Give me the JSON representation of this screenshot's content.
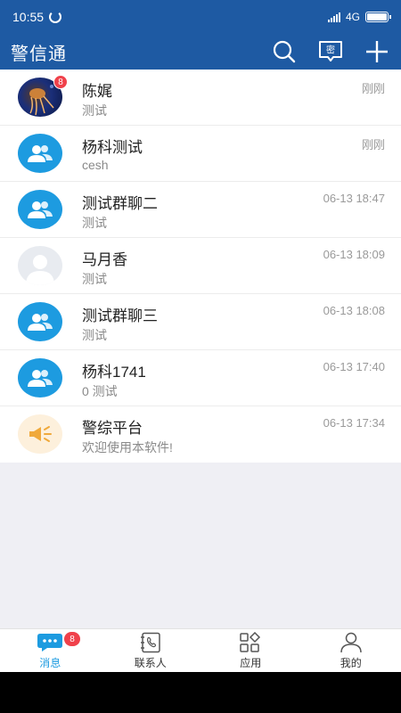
{
  "status_bar": {
    "time": "10:55",
    "network": "4G",
    "battery_level": 1.0
  },
  "header": {
    "title": "警信通",
    "icons": [
      "search-icon",
      "secret-chat-icon",
      "add-icon"
    ],
    "secret_label": "密"
  },
  "conversations": [
    {
      "name": "陈娓",
      "preview": "测试",
      "time": "刚刚",
      "avatar": "photo",
      "unread": "8"
    },
    {
      "name": "杨科测试",
      "preview": "cesh",
      "time": "刚刚",
      "avatar": "group"
    },
    {
      "name": "测试群聊二",
      "preview": "测试",
      "time": "06-13 18:47",
      "avatar": "group"
    },
    {
      "name": "马月香",
      "preview": "测试",
      "time": "06-13 18:09",
      "avatar": "person-default"
    },
    {
      "name": "测试群聊三",
      "preview": "测试",
      "time": "06-13 18:08",
      "avatar": "group"
    },
    {
      "name": "杨科1741",
      "preview": "0 测试",
      "time": "06-13 17:40",
      "avatar": "group"
    },
    {
      "name": "警综平台",
      "preview": "欢迎使用本软件!",
      "time": "06-13 17:34",
      "avatar": "notice"
    }
  ],
  "bottom_nav": {
    "items": [
      {
        "label": "消息",
        "icon": "chat-bubble-icon",
        "active": true,
        "badge": "8"
      },
      {
        "label": "联系人",
        "icon": "phonebook-icon",
        "active": false
      },
      {
        "label": "应用",
        "icon": "apps-grid-icon",
        "active": false
      },
      {
        "label": "我的",
        "icon": "profile-icon",
        "active": false
      }
    ]
  },
  "colors": {
    "header_bg": "#1e5aa3",
    "accent": "#1d9be0",
    "badge": "#f0414b"
  }
}
